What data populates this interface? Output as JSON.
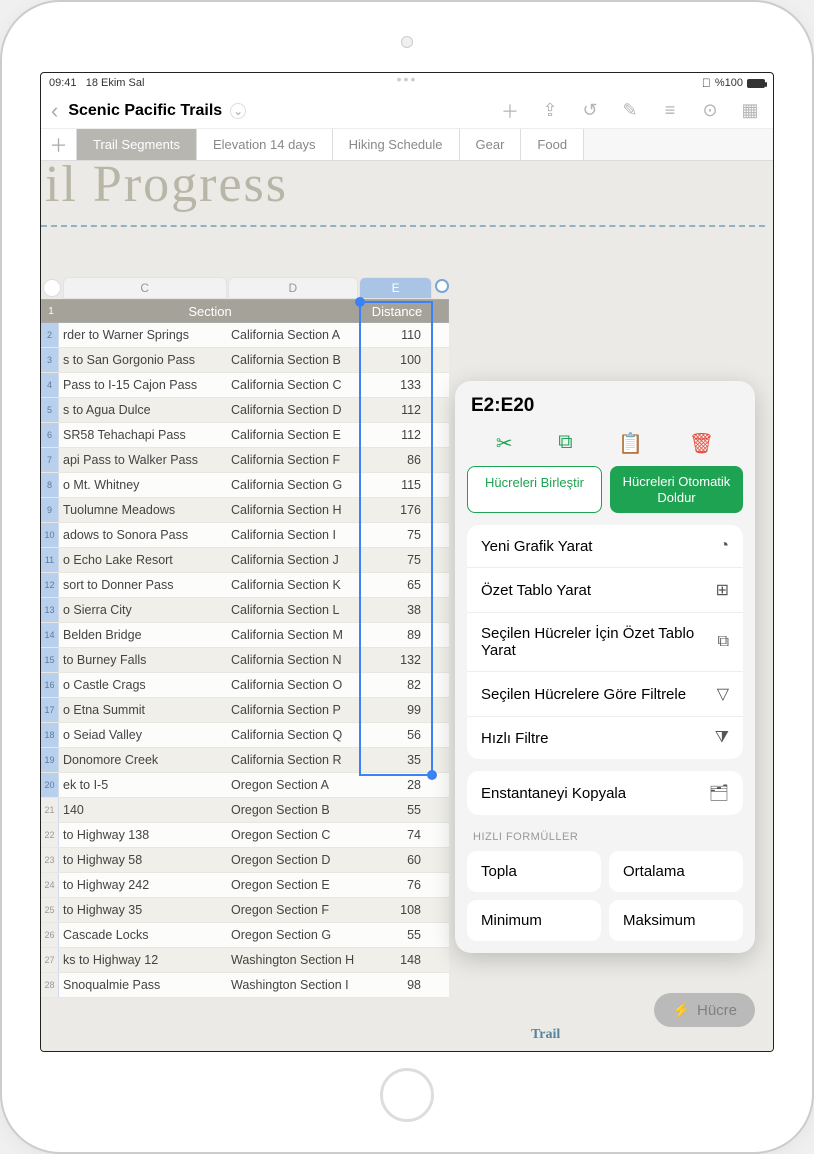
{
  "statusbar": {
    "time": "09:41",
    "date": "18 Ekim Sal",
    "battery": "%100",
    "wifi": "􀙇"
  },
  "document": {
    "title": "Scenic Pacific Trails"
  },
  "sheet_tabs": [
    "Trail Segments",
    "Elevation 14 days",
    "Hiking Schedule",
    "Gear",
    "Food"
  ],
  "canvas_title": "il Progress",
  "columns": {
    "c": "C",
    "d": "D",
    "e": "E"
  },
  "table_header": {
    "section": "Section",
    "distance": "Distance"
  },
  "rows": [
    {
      "n": 2,
      "trail": "rder to Warner Springs",
      "section": "California Section A",
      "dist": 110
    },
    {
      "n": 3,
      "trail": "s to San Gorgonio Pass",
      "section": "California Section B",
      "dist": 100
    },
    {
      "n": 4,
      "trail": "Pass to I-15 Cajon Pass",
      "section": "California Section C",
      "dist": 133
    },
    {
      "n": 5,
      "trail": "s to Agua Dulce",
      "section": "California Section D",
      "dist": 112
    },
    {
      "n": 6,
      "trail": "SR58 Tehachapi Pass",
      "section": "California Section E",
      "dist": 112
    },
    {
      "n": 7,
      "trail": "api Pass to Walker Pass",
      "section": "California Section F",
      "dist": 86
    },
    {
      "n": 8,
      "trail": "o Mt. Whitney",
      "section": "California Section G",
      "dist": 115
    },
    {
      "n": 9,
      "trail": "Tuolumne Meadows",
      "section": "California Section H",
      "dist": 176
    },
    {
      "n": 10,
      "trail": "adows to Sonora Pass",
      "section": "California Section I",
      "dist": 75
    },
    {
      "n": 11,
      "trail": "o Echo Lake Resort",
      "section": "California Section J",
      "dist": 75
    },
    {
      "n": 12,
      "trail": "sort to Donner Pass",
      "section": "California Section K",
      "dist": 65
    },
    {
      "n": 13,
      "trail": "o Sierra City",
      "section": "California Section L",
      "dist": 38
    },
    {
      "n": 14,
      "trail": "Belden Bridge",
      "section": "California Section M",
      "dist": 89
    },
    {
      "n": 15,
      "trail": "to Burney Falls",
      "section": "California Section N",
      "dist": 132
    },
    {
      "n": 16,
      "trail": "o Castle Crags",
      "section": "California Section O",
      "dist": 82
    },
    {
      "n": 17,
      "trail": "o Etna Summit",
      "section": "California Section P",
      "dist": 99
    },
    {
      "n": 18,
      "trail": "o Seiad Valley",
      "section": "California Section Q",
      "dist": 56
    },
    {
      "n": 19,
      "trail": "Donomore Creek",
      "section": "California Section R",
      "dist": 35
    },
    {
      "n": 20,
      "trail": "ek to I-5",
      "section": "Oregon Section A",
      "dist": 28
    },
    {
      "n": 21,
      "trail": "140",
      "section": "Oregon Section B",
      "dist": 55
    },
    {
      "n": 22,
      "trail": "to Highway 138",
      "section": "Oregon Section C",
      "dist": 74
    },
    {
      "n": 23,
      "trail": "to Highway 58",
      "section": "Oregon Section D",
      "dist": 60
    },
    {
      "n": 24,
      "trail": "to Highway 242",
      "section": "Oregon Section E",
      "dist": 76
    },
    {
      "n": 25,
      "trail": "to Highway 35",
      "section": "Oregon Section F",
      "dist": 108
    },
    {
      "n": 26,
      "trail": "Cascade Locks",
      "section": "Oregon Section G",
      "dist": 55
    },
    {
      "n": 27,
      "trail": "ks to Highway 12",
      "section": "Washington Section H",
      "dist": 148
    },
    {
      "n": 28,
      "trail": "Snoqualmie Pass",
      "section": "Washington Section I",
      "dist": 98
    }
  ],
  "popover": {
    "ref": "E2:E20",
    "merge": "Hücreleri Birleştir",
    "autofill": "Hücreleri Otomatik Doldur",
    "menu": [
      "Yeni Grafik Yarat",
      "Özet Tablo Yarat",
      "Seçilen Hücreler İçin Özet Tablo Yarat",
      "Seçilen Hücrelere Göre Filtrele",
      "Hızlı Filtre"
    ],
    "snapshot": "Enstantaneyi Kopyala",
    "formulas_label": "HIZLI FORMÜLLER",
    "formulas": {
      "sum": "Topla",
      "avg": "Ortalama",
      "min": "Minimum",
      "max": "Maksimum"
    }
  },
  "hucre_pill": "Hücre",
  "trail_word": "Trail"
}
